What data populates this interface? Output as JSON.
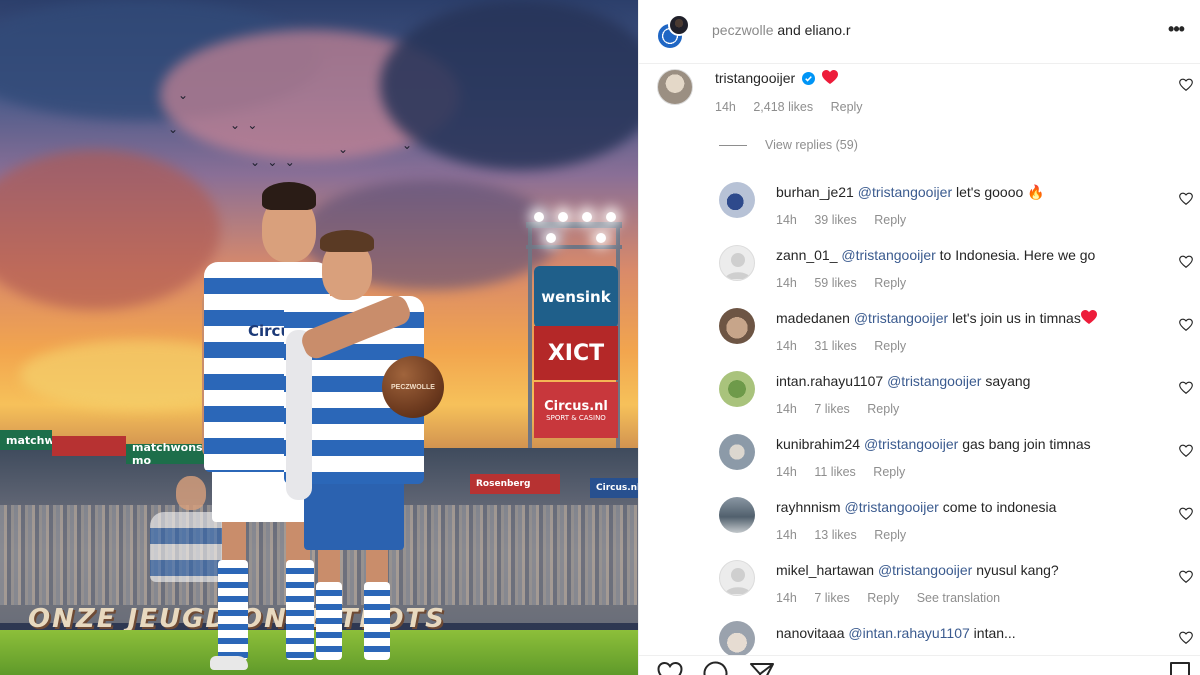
{
  "post": {
    "banner_text": "ONZE JEUGD ONZE TROTS",
    "billboards": [
      "wensink",
      "XICT",
      "Circus.nl"
    ],
    "billboard_sub": "SPORT & CASINO",
    "ad_boards": [
      "matchwons",
      "matchwons mo",
      "Rosenberg",
      "Circus.nl"
    ],
    "ball_text": "PECZWOLLE",
    "sponsor_shirt": "Circus"
  },
  "header": {
    "account1": "peczwolle",
    "conjunction": "and",
    "account2": "eliano.r",
    "more_icon": "more-horizontal-icon"
  },
  "main_comment": {
    "username": "tristangooijer",
    "verified_icon": "verified-badge-icon",
    "emoji": "red-heart-emoji",
    "time": "14h",
    "likes": "2,418 likes",
    "reply": "Reply",
    "view_replies": "View replies (59)"
  },
  "replies": [
    {
      "username": "burhan_je21",
      "mention": "@tristangooijer",
      "text": "let's goooo",
      "emoji": "🔥",
      "time": "14h",
      "likes": "39 likes",
      "reply": "Reply",
      "extra": ""
    },
    {
      "username": "zann_01_",
      "mention": "@tristangooijer",
      "text": "to Indonesia. Here we go",
      "emoji": "",
      "time": "14h",
      "likes": "59 likes",
      "reply": "Reply",
      "extra": ""
    },
    {
      "username": "madedanen",
      "mention": "@tristangooijer",
      "text": "let's join us in timnas",
      "emoji": "red-heart",
      "time": "14h",
      "likes": "31 likes",
      "reply": "Reply",
      "extra": ""
    },
    {
      "username": "intan.rahayu1107",
      "mention": "@tristangooijer",
      "text": "sayang",
      "emoji": "",
      "time": "14h",
      "likes": "7 likes",
      "reply": "Reply",
      "extra": ""
    },
    {
      "username": "kunibrahim24",
      "mention": "@tristangooijer",
      "text": "gas bang join timnas",
      "emoji": "",
      "time": "14h",
      "likes": "11 likes",
      "reply": "Reply",
      "extra": ""
    },
    {
      "username": "rayhnnism",
      "mention": "@tristangooijer",
      "text": "come to indonesia",
      "emoji": "",
      "time": "14h",
      "likes": "13 likes",
      "reply": "Reply",
      "extra": ""
    },
    {
      "username": "mikel_hartawan",
      "mention": "@tristangooijer",
      "text": "nyusul kang?",
      "emoji": "",
      "time": "14h",
      "likes": "7 likes",
      "reply": "Reply",
      "extra": "See translation"
    },
    {
      "username": "nanovitaaa",
      "mention": "@intan.rahayu1107",
      "text": "intan...",
      "emoji": "",
      "time": "",
      "likes": "",
      "reply": "",
      "extra": ""
    }
  ],
  "colors": {
    "mention": "#3b5b8f",
    "meta_gray": "#8e8e8e",
    "verified_blue": "#0095f6",
    "heart_red": "#ed1c3a"
  },
  "actions": [
    "like-icon",
    "comment-icon",
    "share-icon",
    "save-icon"
  ]
}
